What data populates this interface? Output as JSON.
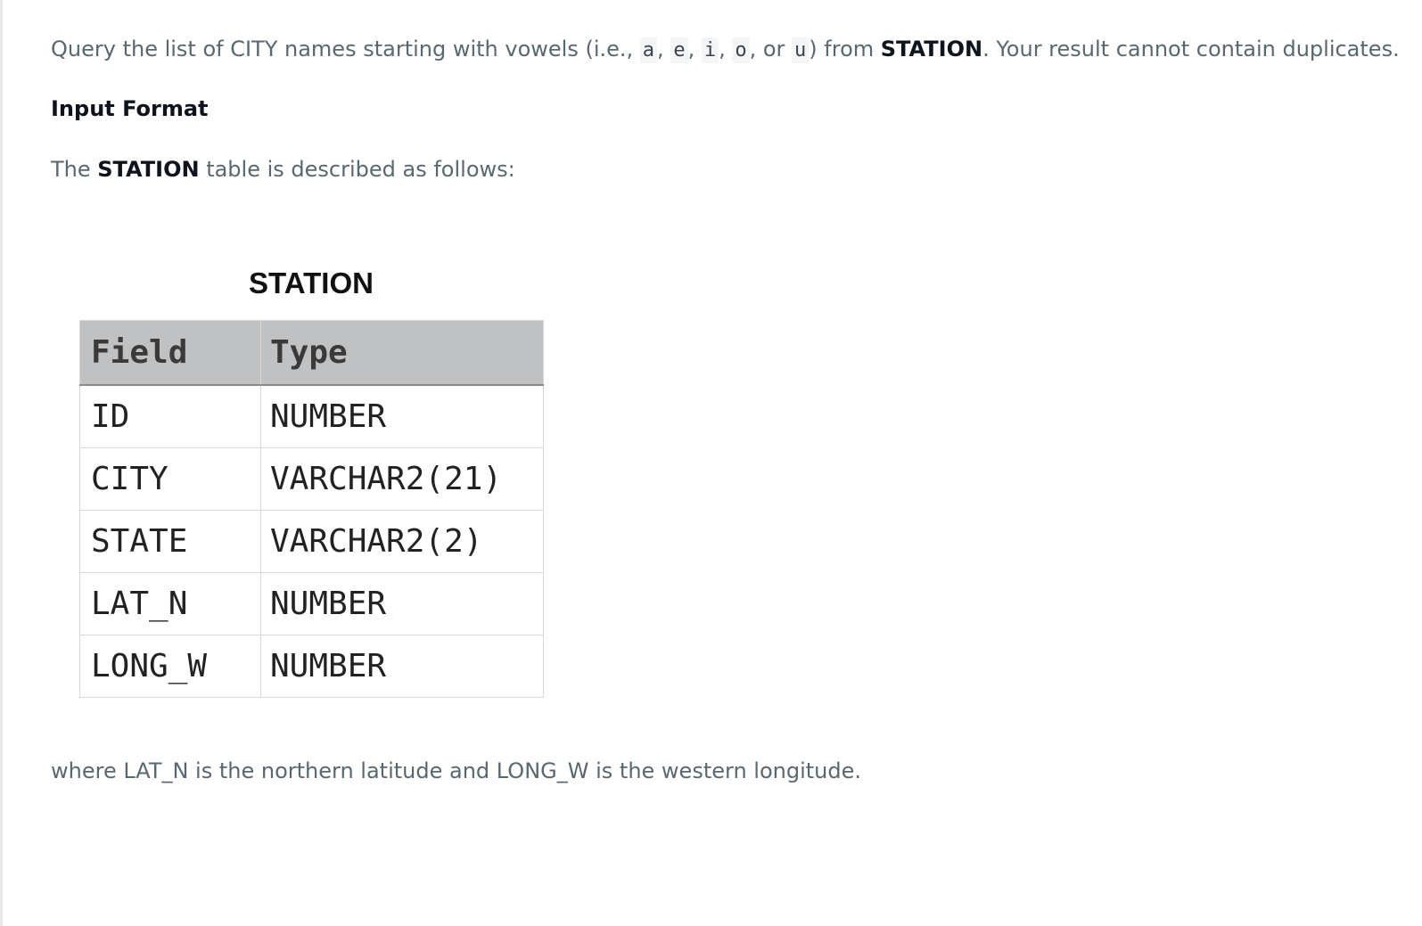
{
  "intro": {
    "prefix": "Query the list of CITY names starting with vowels (i.e., ",
    "vowels": [
      "a",
      "e",
      "i",
      "o",
      "u"
    ],
    "sep1": ", ",
    "sep2": ", ",
    "sep3": ", ",
    "sep4": ", or ",
    "after_vowels": ") from ",
    "table_name": "STATION",
    "suffix": ". Your result cannot contain duplicates."
  },
  "input_format": {
    "heading": "Input Format",
    "desc_prefix": "The ",
    "desc_table": "STATION",
    "desc_suffix": " table is described as follows:"
  },
  "station_table": {
    "title": "STATION",
    "headers": [
      "Field",
      "Type"
    ],
    "rows": [
      [
        "ID",
        "NUMBER"
      ],
      [
        "CITY",
        "VARCHAR2(21)"
      ],
      [
        "STATE",
        "VARCHAR2(2)"
      ],
      [
        "LAT_N",
        "NUMBER"
      ],
      [
        "LONG_W",
        "NUMBER"
      ]
    ]
  },
  "footnote": "where LAT_N is the northern latitude and LONG_W is the western longitude."
}
